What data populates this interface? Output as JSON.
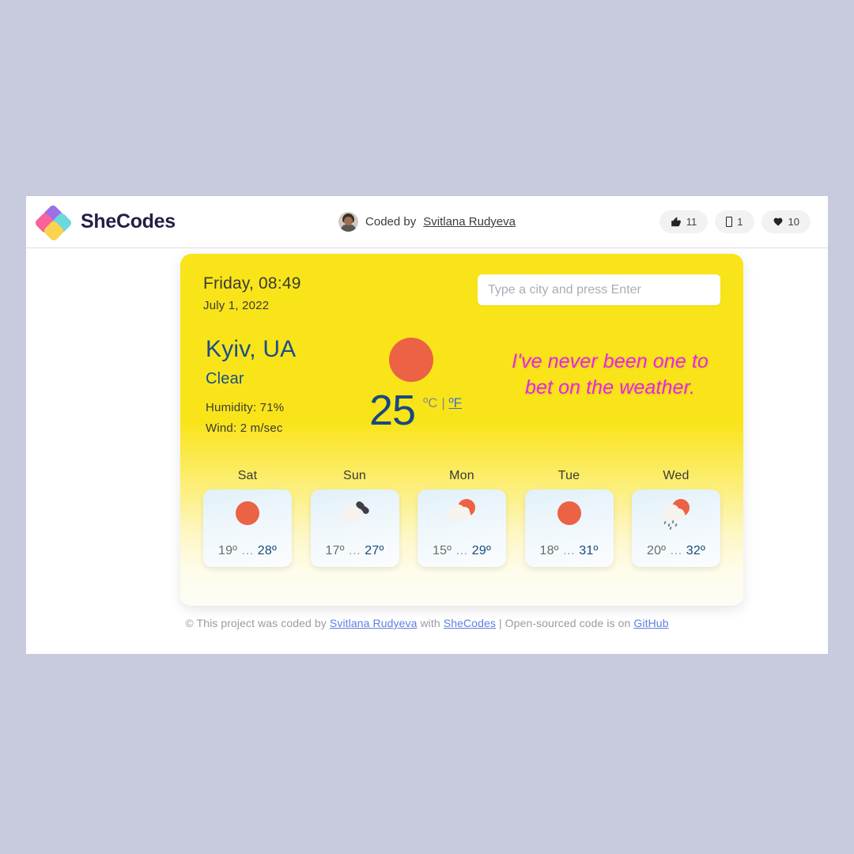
{
  "header": {
    "brand_name": "SheCodes",
    "logo_icon": "shecodes-diamond-logo",
    "credit_prefix": "Coded by",
    "credit_author": "Svitlana Rudyeva",
    "badges": [
      {
        "icon": "thumbs-up-icon",
        "count": "11"
      },
      {
        "icon": "comment-icon",
        "count": "1"
      },
      {
        "icon": "heart-icon",
        "count": "10"
      }
    ]
  },
  "weather": {
    "day_time": "Friday, 08:49",
    "date": "July 1, 2022",
    "search_placeholder": "Type a city and press Enter",
    "search_value": "",
    "city": "Kyiv, UA",
    "condition": "Clear",
    "humidity": "Humidity: 71%",
    "wind": "Wind: 2 m/sec",
    "current_icon": "sun-icon",
    "temperature": "25",
    "unit_celsius": "ºC",
    "unit_separator": "|",
    "unit_fahrenheit": "ºF",
    "quote": "I've never been one to bet on the weather."
  },
  "forecast": [
    {
      "day": "Sat",
      "icon": "sun-icon",
      "min": "19º",
      "sep": "…",
      "max": "28º"
    },
    {
      "day": "Sun",
      "icon": "broken-clouds-icon",
      "min": "17º",
      "sep": "…",
      "max": "27º"
    },
    {
      "day": "Mon",
      "icon": "sun-behind-cloud-icon",
      "min": "15º",
      "sep": "…",
      "max": "29º"
    },
    {
      "day": "Tue",
      "icon": "sun-icon",
      "min": "18º",
      "sep": "…",
      "max": "31º"
    },
    {
      "day": "Wed",
      "icon": "sun-behind-rain-icon",
      "min": "20º",
      "sep": "…",
      "max": "32º"
    }
  ],
  "footer": {
    "part1": "© This project was coded by",
    "author": "Svitlana Rudyeva",
    "part2": "with",
    "org": "SheCodes",
    "part3": "| Open-sourced code is on",
    "repo": "GitHub"
  },
  "colors": {
    "page_background": "#c8cade",
    "card_yellow": "#f9e41a",
    "accent_sun": "#ec6244",
    "accent_blue": "#17497f",
    "quote_magenta": "#e824e8",
    "link_blue": "#5d7fe0"
  }
}
